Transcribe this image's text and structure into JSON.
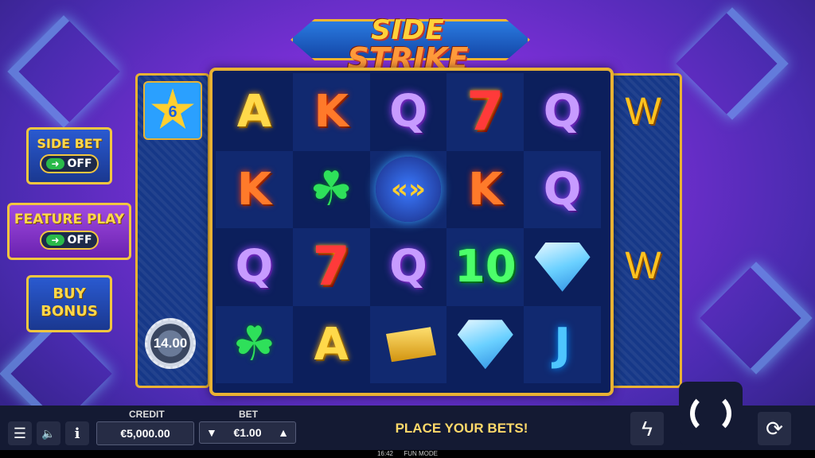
{
  "logo": {
    "line1": "SIDE",
    "line2": "STRIKE"
  },
  "reels": {
    "rows": [
      [
        "A",
        "K",
        "Q",
        "7",
        "Q"
      ],
      [
        "K",
        "clover",
        "strike",
        "K",
        "Q"
      ],
      [
        "Q",
        "7",
        "Q",
        "10",
        "diamond"
      ],
      [
        "clover",
        "A",
        "gold",
        "diamond",
        "J"
      ]
    ]
  },
  "left_column": {
    "star_value": "6",
    "chip_value": "14.00"
  },
  "right_column": {
    "wild_1": "W",
    "wild_2": "W"
  },
  "side_bet": {
    "label": "SIDE BET",
    "toggle_text": "OFF",
    "arrow": "➜"
  },
  "feature_play": {
    "label": "FEATURE PLAY",
    "toggle_text": "OFF",
    "arrow": "➜"
  },
  "buy_bonus": {
    "line1": "BUY",
    "line2": "BONUS"
  },
  "bottom_bar": {
    "menu_icon": "☰",
    "sound_icon": "🔈",
    "info_icon": "i",
    "credit_label": "CREDIT",
    "credit_value": "€5,000.00",
    "bet_label": "BET",
    "bet_value": "€1.00",
    "bet_down": "▼",
    "bet_up": "▲",
    "message": "PLACE YOUR BETS!",
    "turbo_icon": "ϟ",
    "autoplay_icon": "⟳"
  },
  "status": {
    "time": "16:42",
    "mode": "FUN MODE"
  }
}
